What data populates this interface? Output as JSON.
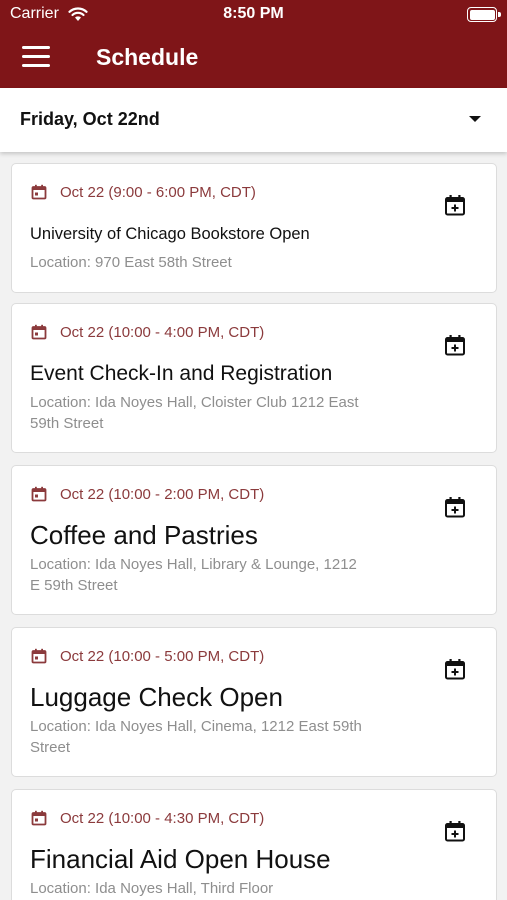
{
  "status": {
    "carrier": "Carrier",
    "time": "8:50 PM"
  },
  "header": {
    "title": "Schedule"
  },
  "date_selector": {
    "value": "Friday, Oct 22nd"
  },
  "events": [
    {
      "when": "Oct 22 (9:00 - 6:00 PM, CDT)",
      "name": "University of Chicago Bookstore Open",
      "location": "Location: 970 East 58th Street"
    },
    {
      "when": "Oct 22 (10:00 - 4:00 PM, CDT)",
      "name": "Event Check-In and Registration",
      "location": "Location: Ida Noyes Hall, Cloister Club 1212 East 59th Street"
    },
    {
      "when": "Oct 22 (10:00 - 2:00 PM, CDT)",
      "name": "Coffee and Pastries",
      "location": "Location: Ida Noyes Hall, Library & Lounge, 1212 E 59th Street"
    },
    {
      "when": "Oct 22 (10:00 - 5:00 PM, CDT)",
      "name": "Luggage Check Open",
      "location": "Location: Ida Noyes Hall, Cinema, 1212 East 59th Street"
    },
    {
      "when": "Oct 22 (10:00 - 4:30 PM, CDT)",
      "name": "Financial Aid Open House",
      "location": "Location: Ida Noyes Hall, Third Floor"
    }
  ],
  "colors": {
    "brand": "#7f1518",
    "accent_text": "#8b3a3c",
    "secondary_text": "#8e8e8e"
  },
  "icons": {
    "menu": "hamburger-menu-icon",
    "event_date": "calendar-icon",
    "add": "calendar-add-icon"
  }
}
